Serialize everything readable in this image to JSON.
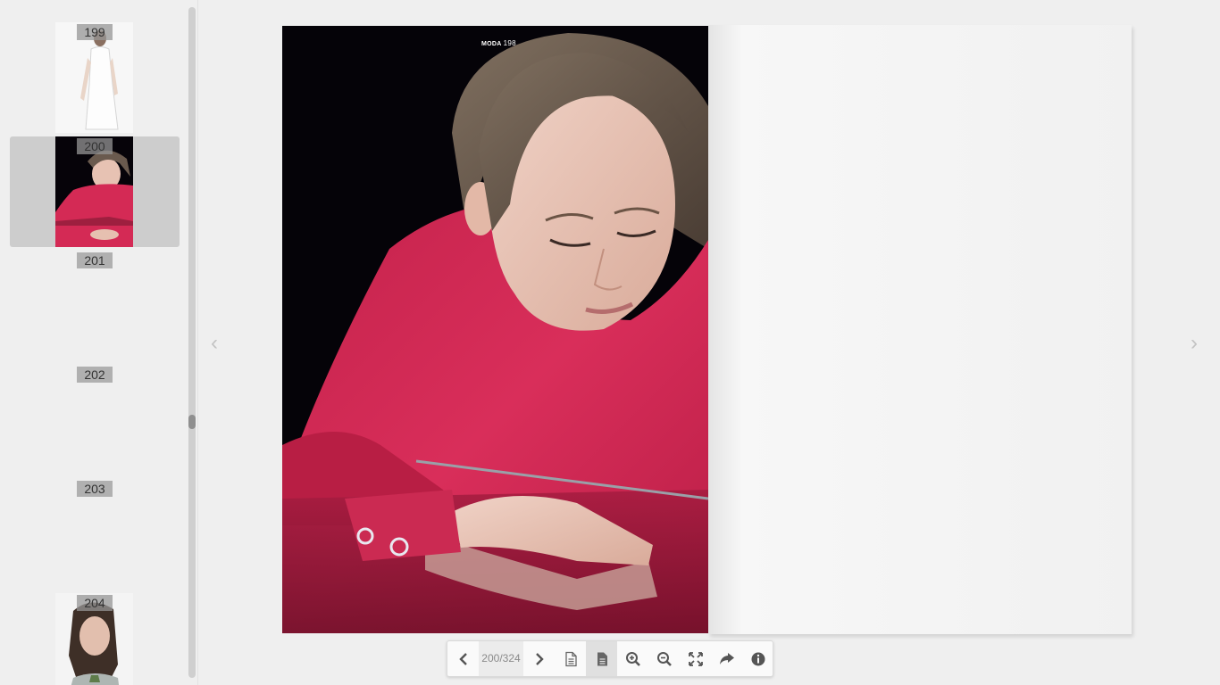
{
  "sidebar": {
    "thumbnails": [
      {
        "label": "199"
      },
      {
        "label": "200"
      },
      {
        "label": "201"
      },
      {
        "label": "202"
      },
      {
        "label": "203"
      },
      {
        "label": "204"
      }
    ]
  },
  "book": {
    "left_page": {
      "section": "MODA",
      "page_number": "198"
    }
  },
  "toolbar": {
    "page_indicator": "200/324",
    "buttons": [
      "prev-icon",
      "next-icon",
      "single-page-icon",
      "double-page-icon",
      "zoom-in-icon",
      "zoom-out-icon",
      "fullscreen-icon",
      "share-icon",
      "info-icon"
    ]
  },
  "colors": {
    "dress": "#d42a55",
    "background": "#efefef",
    "active_thumb": "#cdcdcd"
  }
}
